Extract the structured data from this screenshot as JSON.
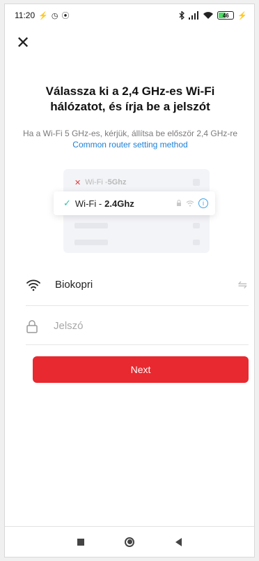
{
  "status_bar": {
    "time": "11:20",
    "left_icons": [
      "⚡",
      "◷",
      "⦿"
    ],
    "right_icons": [
      "bluetooth-icon",
      "signal-icon",
      "wifi-icon"
    ],
    "battery": "46"
  },
  "header": {
    "close_label": "✕"
  },
  "title": "Válassza ki a 2,4 GHz-es Wi-Fi hálózatot, és írja be a jelszót",
  "subtitle": {
    "text": "Ha a Wi-Fi 5 GHz-es, kérjük, állítsa be először 2,4 GHz-re ",
    "link": "Common router setting method"
  },
  "illustration": {
    "rejected_label": "Wi-Fi - ",
    "rejected_band": "5Ghz",
    "selected_label": "Wi-Fi - ",
    "selected_band": "2.4Ghz",
    "info_glyph": "i"
  },
  "wifi_field": {
    "network_name": "Biokopri",
    "switch_glyph": "⇋"
  },
  "password_field": {
    "placeholder": "Jelszó",
    "value": ""
  },
  "next_button": {
    "label": "Next"
  },
  "colors": {
    "accent_red": "#e8292f",
    "link_blue": "#1c7fd6",
    "check_green": "#2ec4a8",
    "reject_red": "#e5383b"
  }
}
